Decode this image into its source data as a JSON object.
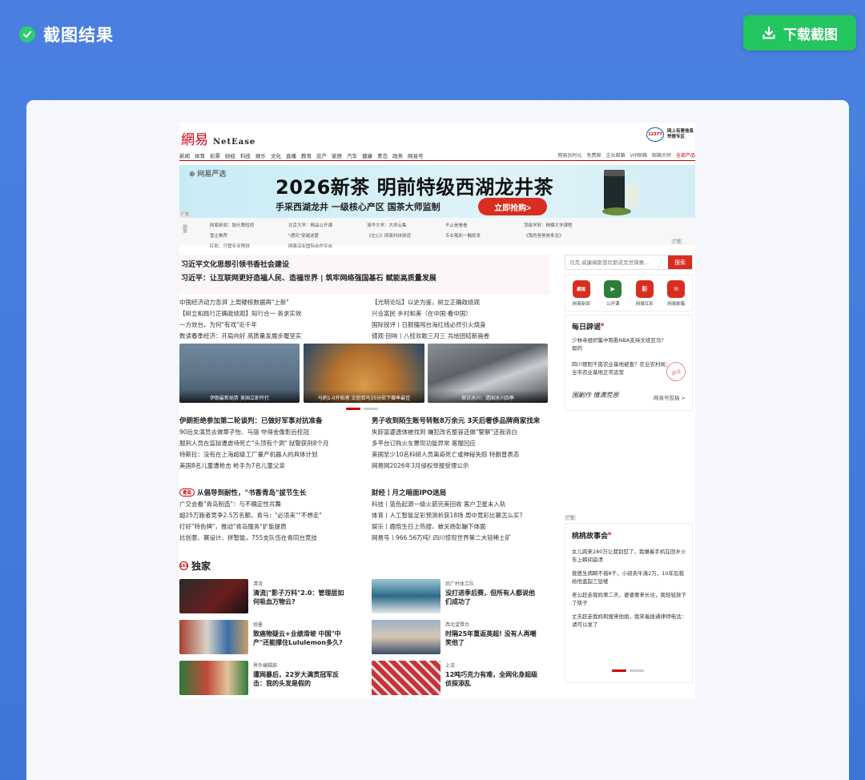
{
  "header": {
    "title": "截图结果",
    "download_label": "下载截图",
    "colors": {
      "bar": "#4a7fdf",
      "button": "#22c55e",
      "check": "#2ecc71"
    }
  },
  "site": {
    "logo_cn": "網易",
    "logo_en": "NetEase",
    "report_badge": "12377",
    "report_lines": [
      "网上有害信息",
      "举报专区"
    ],
    "nav": [
      "新闻",
      "体育",
      "彩票",
      "财经",
      "科技",
      "娱乐",
      "文化",
      "直播",
      "教育",
      "房产",
      "家居",
      "汽车",
      "健康",
      "青岛",
      "政务",
      "网易号"
    ],
    "nav_right": [
      "网易员时元",
      "免费邮",
      "企业邮箱",
      "VIP邮箱",
      "邮箱大师",
      "全部产品"
    ]
  },
  "banner": {
    "brand": "网易严选",
    "main": "2026新茶 明前特级西湖龙井茶",
    "sub": "手采西湖龙井  一级核心产区  国茶大师监制",
    "cta": "立即抢购>",
    "ad": "广告"
  },
  "sublinks": {
    "tag": "网易",
    "items": [
      "网易新闻：独头鹰短视",
      "北京大学：精品公开课",
      "清华大学：大师云集",
      "不止是看看",
      "顶级学府：精模大学课程",
      "壹企推荐",
      "\"通讯\"穿越迷雾",
      "《左心》网易科技频道",
      "专业冤彩一触即发",
      "《我的爸爸是条龙》",
      "红彩、只管专业预测",
      "网易沿业国际合作平台"
    ],
    "ad": "广告"
  },
  "headlines": {
    "line1": "习近平文化思想引领书香社会建设",
    "line2": "习近平：让互联网更好造福人民、造福世界 | 筑牢网络强国基石 赋能高质量发展"
  },
  "news_left": [
    "中国经济动力澎湃 上周硬核数据再\"上新\"",
    "【树立和践行正确政绩观】知行合一 务求实效",
    "一方效台，为何\"有戏\"近千年",
    "数读春季经济：开局向好 高质量发展步履坚实"
  ],
  "news_right": [
    "【光明论坛】以史为鉴，树立正确政绩观",
    "兴业富民 乡村和美（在中国·看中国）",
    "国际锐评丨日舰擅闯台海红线必然引火烧身",
    "镜观·回响丨八桂欢歌三月三 共绘团结新画卷"
  ],
  "photos": [
    "伊朗最新局势 美国立即开打",
    "马刺1-0开拓者 文班亚马35分砍下赛季最佳",
    "探访冰川：透国冰川四季"
  ],
  "section_a": {
    "title": "伊朗拒绝参加第二轮谈判：已做好军事对抗准备",
    "items": [
      "90后女演员去做章子怡、马丽 夺得金像影后桂冠",
      "服刑人员在监狱遭虐待死亡\"头顶有个洞\" 狱警获刑8个月",
      "特斯拉：没有在上海超级工厂量产机器人的具体计划",
      "美国8名儿童遭枪击 枪手为7名儿童父亲"
    ]
  },
  "section_b": {
    "title": "男子收到陌生账号转账8万余元 3天后奢侈品牌商家找来",
    "items": [
      "失踪富婆遗体被找到 嫌犯改名整容还做\"警察\"还我清白",
      "多平台订购火车票现功能异常 客服回应",
      "美国至少10名科研人员离奇死亡或神秘失踪 特朗普表态",
      "网易网2026年3月侵权举报受理公示"
    ]
  },
  "section_c": {
    "tag": "青岛",
    "title": "从倡导到耐性，\"书香青岛\"拔节生长",
    "items": [
      "广交会看\"青岛制造\"：与不确定性共舞",
      "超25万跑者竞争2.5万名额，青马：\"必须来\"\"不想走\"",
      "打好\"特色牌\"，推动\"青岛服务\"扩能提质",
      "比创意、赛设计、拼智能，755支队伍在青同台竞技"
    ]
  },
  "section_d": {
    "title": "财经丨月之暗面IPO迷局",
    "items": [
      "科技丨蓝色起源一级火箭完美回收 客户卫星未入轨",
      "体育丨人工智能足彩预测析获18场 周中竞彩比赛怎么买?",
      "娱乐丨鹿晗生日上热搜，被关扬彭蹦下体面",
      "网易号丨966.56万吨! 四川惊现世界第二大轻稀土矿"
    ]
  },
  "exclusive": {
    "icon": "163",
    "title": "独家",
    "items": [
      {
        "src": "清流",
        "title": "清流|\"影子万科\"2.0：管理层如何吸血万物云?"
      },
      {
        "src": "后厂村体工队",
        "title": "没打进季后赛，但所有人都说他们成功了"
      },
      {
        "src": "锐墨",
        "title": "致癌物疑云+业绩滑坡 中国\"中产\"还能撑住Lululemon多久?"
      },
      {
        "src": "西北望晋台",
        "title": "时隔25年重返英超! 没有人再嘲笑他了"
      },
      {
        "src": "界外编辑部",
        "title": "遭网暴后，22岁大满贯冠军反击：我的头发是假的"
      },
      {
        "src": "上流",
        "title": "12吨巧克力有难，全网化身超级侦探添乱"
      }
    ]
  },
  "search": {
    "placeholder": "马克·威廉姆斯冒险斯诺克世锦赛...",
    "button": "搜索"
  },
  "apps": [
    {
      "label": "网易新闻",
      "glyph": "網易",
      "color": "#d92d20"
    },
    {
      "label": "公开课",
      "glyph": "▶",
      "color": "#2f7d3a"
    },
    {
      "label": "网易红彩",
      "glyph": "彩",
      "color": "#d92d20"
    },
    {
      "label": "网易邮箱",
      "glyph": "✉",
      "color": "#d92d20"
    }
  ],
  "daily": {
    "title": "每日辟谣",
    "items": [
      "少林寺组织集中观看NBA支持文班亚马？假的",
      "四川德阳千亩农业基地被查？农业农村局：全市农业基地正常运营"
    ],
    "stamp": "辟谣",
    "footer_sign": "围剿作 情满荒原",
    "footer_link": "网易号投稿 >"
  },
  "story": {
    "ad": "广告",
    "title": "桃桃故事会",
    "items": [
      "女儿跨来280万让我别怼了，我嫌着手机在回乡火车上瞬间崩溃",
      "我爸生病瞬不借8千，小叔卖牛凑2万，10年后我给他盖起三层楼",
      "老公赶走我妈第二天，婆婆要来长住，我轻轻放下了筷子",
      "丈夫赶走我妈和嫂来他姐，我笑着拨通律师电话：请可以发了"
    ]
  }
}
